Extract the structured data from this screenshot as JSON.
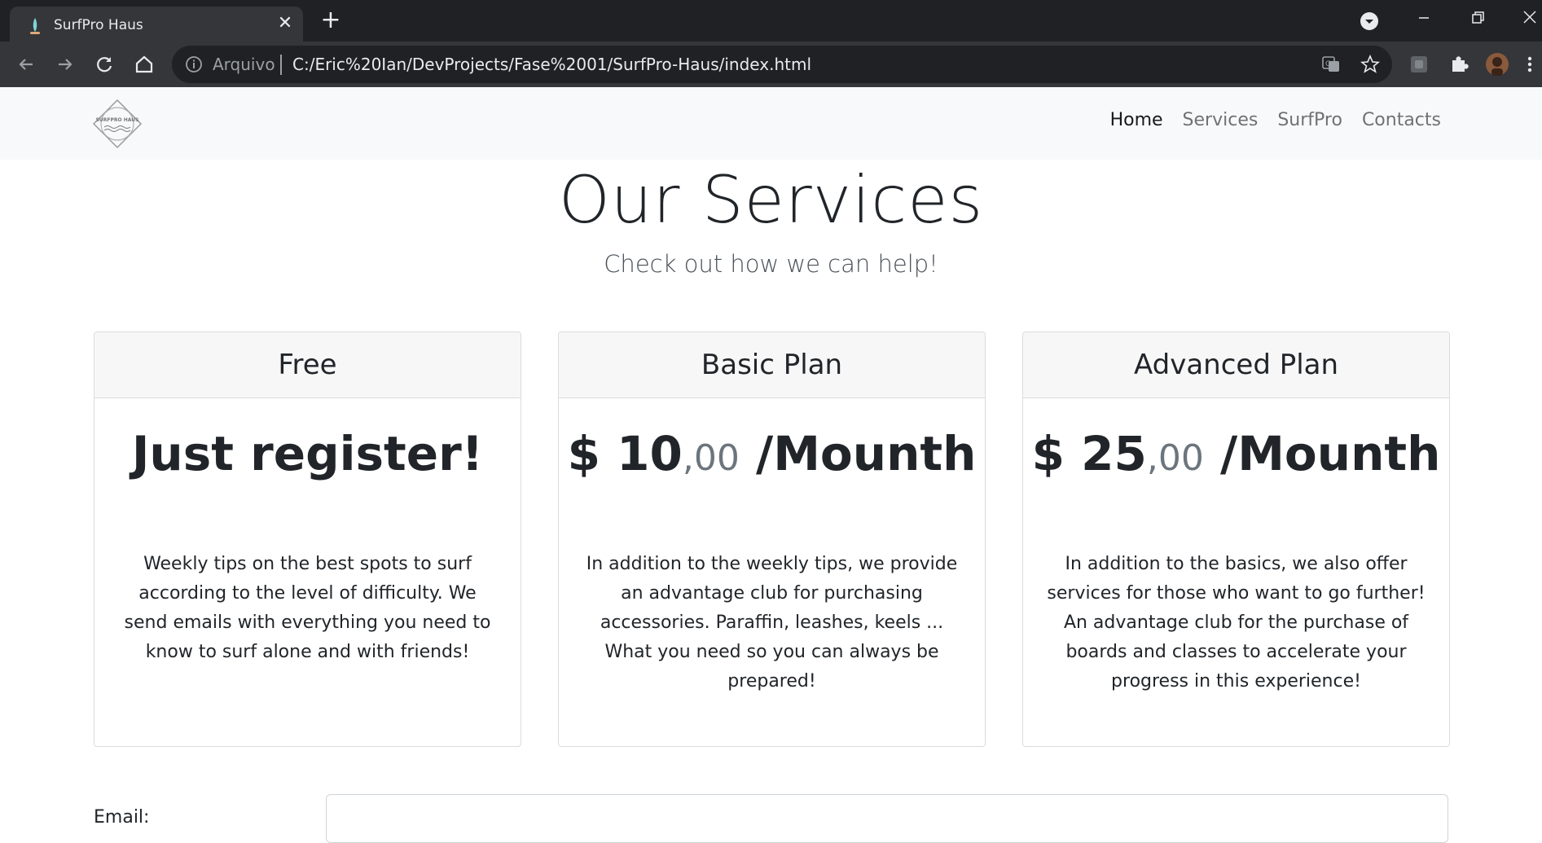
{
  "browser": {
    "tab_title": "SurfPro Haus",
    "new_tab_symbol": "+",
    "close_symbol": "✕",
    "omnibox_label": "Arquivo",
    "url": "C:/Eric%20Ian/DevProjects/Fase%2001/SurfPro-Haus/index.html",
    "icons": [
      "back-icon",
      "forward-icon",
      "reload-icon",
      "home-icon",
      "info-icon",
      "translate-icon",
      "star-icon",
      "extension-icon",
      "puzzle-icon",
      "profile-avatar",
      "menu-icon",
      "tab-search-icon",
      "minimize-icon",
      "restore-icon",
      "close-icon"
    ]
  },
  "site": {
    "logo_text": "SURFPRO HAUS",
    "nav": [
      "Home",
      "Services",
      "SurfPro",
      "Contacts"
    ],
    "active_nav": "Home"
  },
  "hero": {
    "title": "Our Services",
    "subtitle": "Check out how we can help!"
  },
  "plans": [
    {
      "name": "Free",
      "price_main": "Just register!",
      "price_cents": "",
      "price_suffix": "",
      "description": "Weekly tips on the best spots to surf according to the level of difficulty. We send emails with everything you need to know to surf alone and with friends!"
    },
    {
      "name": "Basic Plan",
      "price_main": "$ 10",
      "price_cents": ",00",
      "price_suffix": " /Mounth",
      "description": "In addition to the weekly tips, we provide an advantage club for purchasing accessories. Paraffin, leashes, keels ... What you need so you can always be prepared!"
    },
    {
      "name": "Advanced Plan",
      "price_main": "$ 25",
      "price_cents": ",00",
      "price_suffix": " /Mounth",
      "description": "In addition to the basics, we also offer services for those who want to go further! An advantage club for the purchase of boards and classes to accelerate your progress in this experience!"
    }
  ],
  "form": {
    "email_label": "Email:",
    "email_value": ""
  },
  "colors": {
    "chrome_dark": "#202124",
    "chrome_toolbar": "#35363a",
    "navbar_bg": "#f8f9fa",
    "card_header_bg": "#f7f7f7",
    "muted_text": "#6c757d"
  }
}
